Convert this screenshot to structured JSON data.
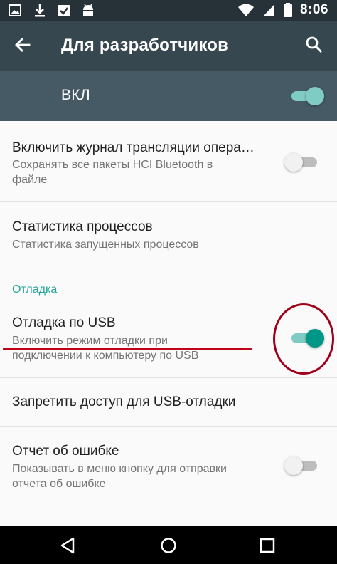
{
  "status_bar": {
    "time": "8:06",
    "left_icons": [
      "image-icon",
      "download-icon",
      "gallery-check-icon",
      "android-icon"
    ],
    "right_icons": [
      "wifi-icon",
      "signal-icon",
      "battery-icon"
    ]
  },
  "toolbar": {
    "title": "Для разработчиков",
    "back_icon": "arrow-left-icon",
    "search_icon": "search-icon"
  },
  "master_switch": {
    "label": "ВКЛ",
    "state": "on"
  },
  "settings": [
    {
      "title": "Включить журнал трансляции опера…",
      "subtitle_line1": "Сохранять все пакеты HCI Bluetooth в",
      "subtitle_line2": "файле",
      "toggle": "off"
    },
    {
      "title": "Статистика процессов",
      "subtitle_line1": "Статистика запущенных процессов"
    },
    {
      "section_header": "Отладка"
    },
    {
      "title": "Отладка по USB",
      "subtitle_line1": "Включить режим отладки при",
      "subtitle_line2": "подключении к компьютеру по USB",
      "toggle": "on"
    },
    {
      "title": "Запретить доступ для USB-отладки"
    },
    {
      "title": "Отчет об ошибке",
      "subtitle_line1": "Показывать в меню кнопку для отправки",
      "subtitle_line2": "отчета об ошибке",
      "toggle": "off"
    }
  ],
  "nav_bar": {
    "buttons": [
      "back-triangle-icon",
      "home-circle-icon",
      "recents-square-icon"
    ]
  },
  "colors": {
    "status_bar": "#263238",
    "toolbar": "#37474f",
    "master_bar": "#455a64",
    "accent": "#009688",
    "annotation_red": "#c0001a"
  }
}
